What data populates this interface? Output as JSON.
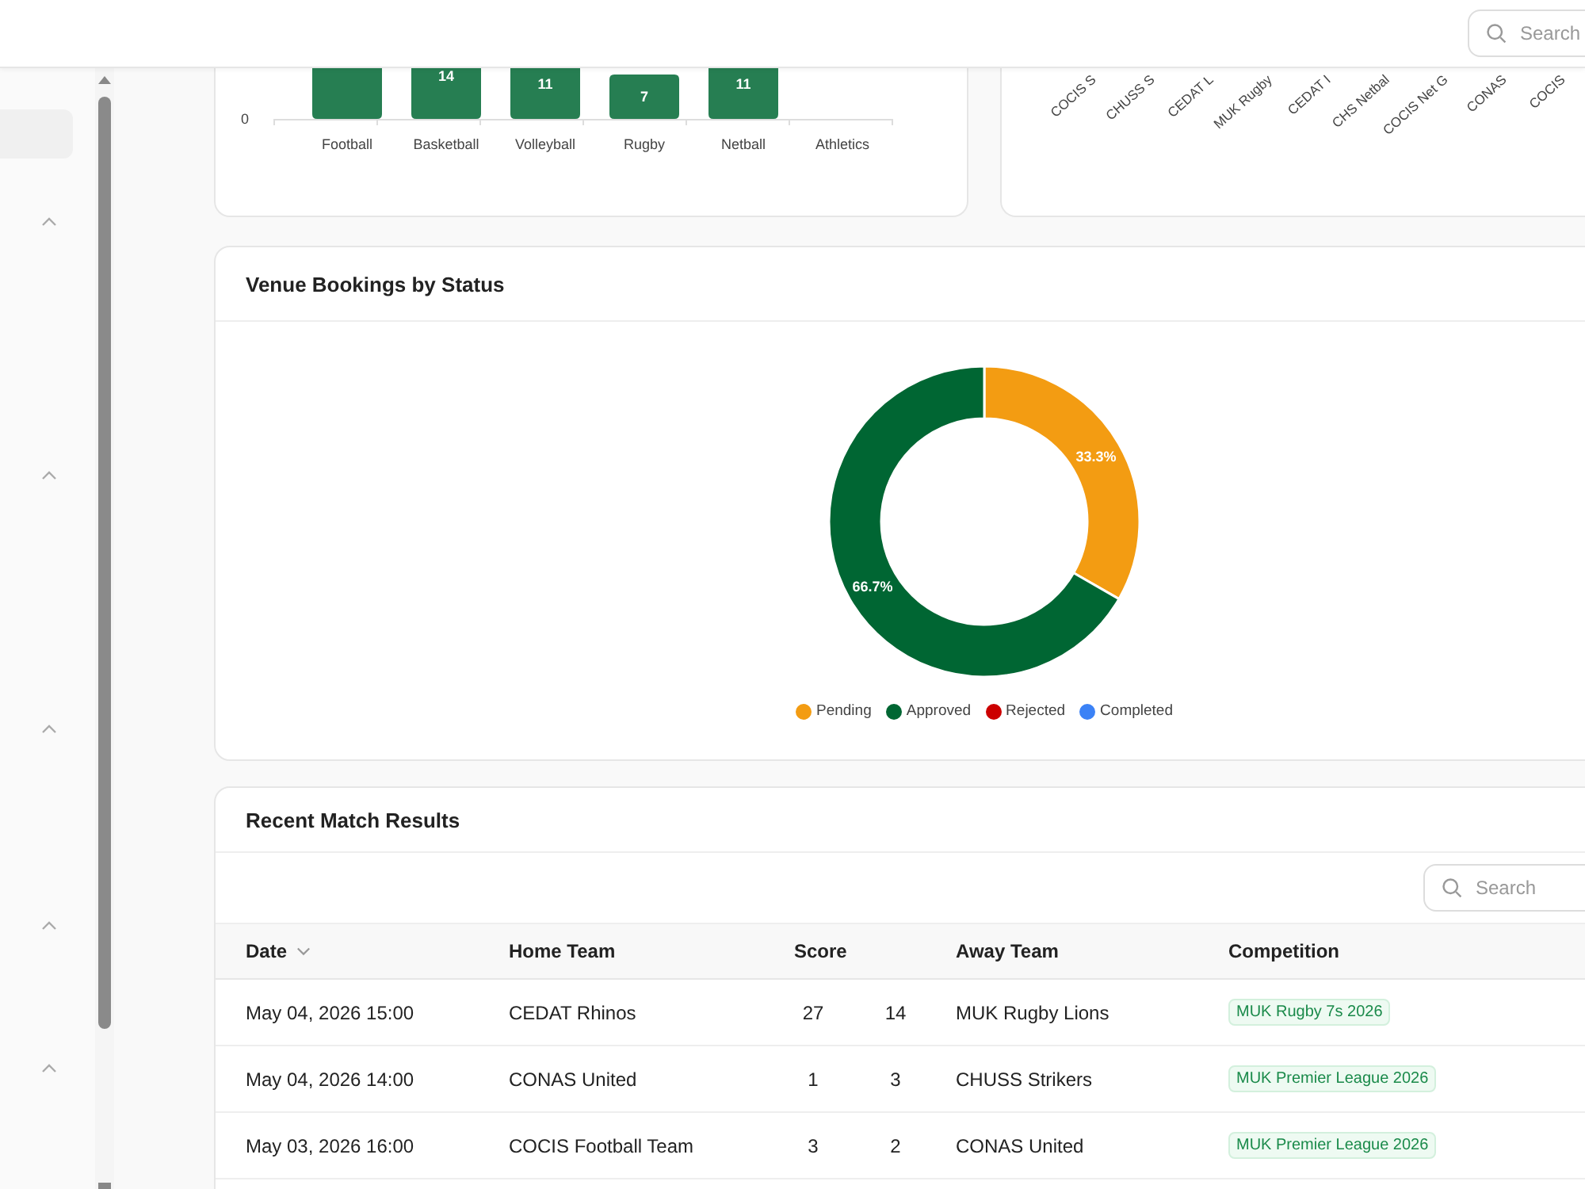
{
  "topbar": {
    "search": {
      "placeholder": "Search"
    }
  },
  "sidebar": {
    "groups": [
      {
        "expanded": true
      },
      {
        "expanded": true
      },
      {
        "expanded": true
      },
      {
        "expanded": true
      },
      {
        "expanded": true
      }
    ]
  },
  "sport_chart": {
    "y_axis_tick": "0",
    "bars": [
      {
        "category": "Football",
        "kind": "cut"
      },
      {
        "category": "Basketball",
        "kind": "cut",
        "value_label": "14"
      },
      {
        "category": "Volleyball",
        "kind": "cut",
        "value_label": "11"
      },
      {
        "category": "Rugby",
        "kind": "short",
        "value_label": "7"
      },
      {
        "category": "Netball",
        "kind": "cut",
        "value_label": "11"
      },
      {
        "category": "Athletics",
        "kind": "empty"
      }
    ]
  },
  "team_chart": {
    "axis_labels": [
      "COCIS S",
      "CHUSS S",
      "CEDAT L",
      "MUK Rugby",
      "CEDAT I",
      "CHS Netbal",
      "COCIS Net G",
      "CONAS",
      "COCIS"
    ]
  },
  "bookings": {
    "title": "Venue Bookings by Status",
    "chart_data": {
      "type": "donut",
      "categories": [
        "Pending",
        "Approved",
        "Rejected",
        "Completed"
      ],
      "values": [
        33.3,
        66.7,
        0,
        0
      ],
      "colors": [
        "#f39c12",
        "#006633",
        "#cc0000",
        "#3b82f6"
      ],
      "value_labels": [
        "33.3%",
        "66.7%",
        null,
        null
      ]
    }
  },
  "results": {
    "title": "Recent Match Results",
    "search": {
      "placeholder": "Search"
    },
    "columns": [
      {
        "label": "Date",
        "sorted": true
      },
      {
        "label": "Home Team",
        "sorted": false
      },
      {
        "label": "Score",
        "sorted": false
      },
      {
        "label": "Away Team",
        "sorted": false
      },
      {
        "label": "Competition",
        "sorted": false
      }
    ],
    "rows": [
      {
        "date": "May 04, 2026 15:00",
        "home_team": "CEDAT Rhinos",
        "home_score": "27",
        "away_score": "14",
        "away_team": "MUK Rugby Lions",
        "competition": "MUK Rugby 7s 2026"
      },
      {
        "date": "May 04, 2026 14:00",
        "home_team": "CONAS United",
        "home_score": "1",
        "away_score": "3",
        "away_team": "CHUSS Strikers",
        "competition": "MUK Premier League 2026"
      },
      {
        "date": "May 03, 2026 16:00",
        "home_team": "COCIS Football Team",
        "home_score": "3",
        "away_score": "2",
        "away_team": "CONAS United",
        "competition": "MUK Premier League 2026"
      }
    ]
  }
}
